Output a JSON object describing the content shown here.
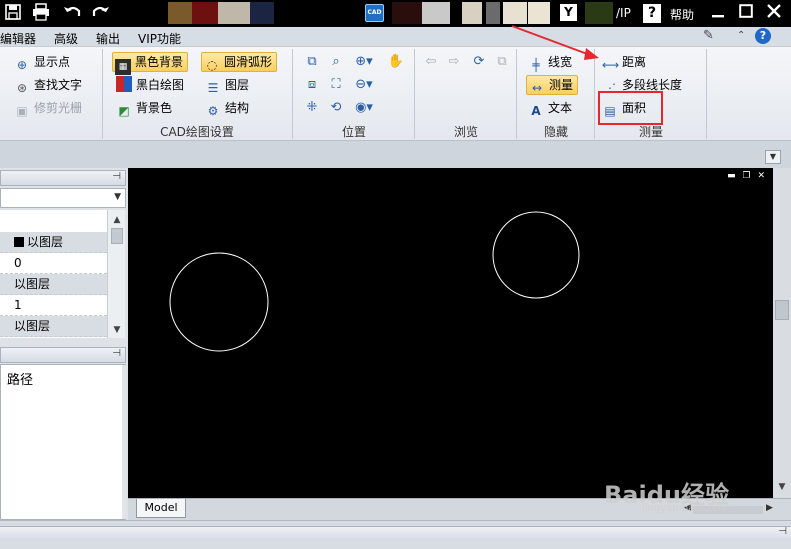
{
  "titlebar": {
    "app_badge": "CAD",
    "vip_text": "/IP",
    "help_text": "帮助",
    "icons": [
      "save-icon",
      "print-icon",
      "undo-icon",
      "redo-icon",
      "help-question-icon",
      "minimize-icon",
      "maximize-icon",
      "close-icon"
    ]
  },
  "menubar": {
    "items": [
      "编辑器",
      "高级",
      "输出",
      "VIP功能"
    ]
  },
  "ribbon": {
    "group1": {
      "label": "",
      "buttons": [
        "显示点",
        "查找文字",
        "修剪光栅"
      ]
    },
    "group2": {
      "label": "CAD绘图设置",
      "buttons": [
        "黑色背景",
        "黑白绘图",
        "背景色",
        "圆滑弧形",
        "图层",
        "结构"
      ]
    },
    "group3": {
      "label": "位置"
    },
    "group4": {
      "label": "浏览"
    },
    "group5": {
      "label": "隐藏",
      "buttons": [
        "线宽",
        "测量",
        "文本"
      ]
    },
    "group6": {
      "label": "测量",
      "buttons": [
        "距离",
        "多段线长度",
        "面积"
      ]
    }
  },
  "left_panel": {
    "properties": [
      "以图层",
      "0",
      "以图层",
      "1",
      "以图层"
    ],
    "path_label": "路径"
  },
  "bottom": {
    "model_tab": "Model"
  },
  "watermark": {
    "brand": "Baidu经验",
    "url": "jingyan.baidu.com"
  },
  "colors": {
    "highlight_box": "#e8262e",
    "active_button": "#f9cf5e",
    "canvas_bg": "#000000",
    "circle_stroke": "#ffffff"
  }
}
